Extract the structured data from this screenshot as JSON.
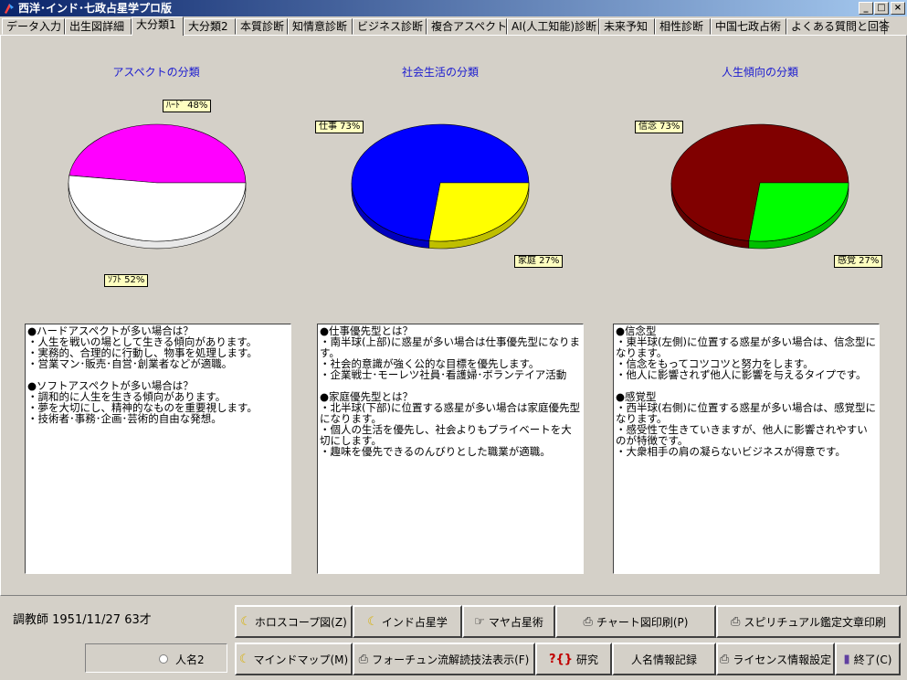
{
  "window": {
    "title": "西洋･インド･七政占星学プロ版",
    "buttons": {
      "minimize": "_",
      "maximize": "□",
      "close": "×"
    }
  },
  "tabs": [
    {
      "label": "データ入力"
    },
    {
      "label": "出生図詳細"
    },
    {
      "label": "大分類1",
      "active": true
    },
    {
      "label": "大分類2"
    },
    {
      "label": "本質診断"
    },
    {
      "label": "知情意診断"
    },
    {
      "label": "ビジネス診断"
    },
    {
      "label": "複合アスペクト"
    },
    {
      "label": "AI(人工知能)診断"
    },
    {
      "label": "未来予知"
    },
    {
      "label": "相性診断"
    },
    {
      "label": "中国七政占術"
    },
    {
      "label": "よくある質問と回答"
    }
  ],
  "chart_data": [
    {
      "type": "pie",
      "title": "アスペクトの分類",
      "slices": [
        {
          "label": "ﾊｰﾄﾞ",
          "value": 48,
          "callout": "ﾊｰﾄﾞ 48%",
          "color": "#ff00ff"
        },
        {
          "label": "ｿﾌﾄ",
          "value": 52,
          "callout": "ｿﾌﾄ 52%",
          "color": "#ffffff"
        }
      ]
    },
    {
      "type": "pie",
      "title": "社会生活の分類",
      "slices": [
        {
          "label": "仕事",
          "value": 73,
          "callout": "仕事 73%",
          "color": "#0000ff"
        },
        {
          "label": "家庭",
          "value": 27,
          "callout": "家庭 27%",
          "color": "#ffff00"
        }
      ]
    },
    {
      "type": "pie",
      "title": "人生傾向の分類",
      "slices": [
        {
          "label": "信念",
          "value": 73,
          "callout": "信念 73%",
          "color": "#800000"
        },
        {
          "label": "感覚",
          "value": 27,
          "callout": "感覚 27%",
          "color": "#00ff00"
        }
      ]
    }
  ],
  "descriptions": [
    "●ハードアスペクトが多い場合は？\n・人生を戦いの場として生きる傾向があります。\n・実務的、合理的に行動し、物事を処理します。\n・営業マン･販売･自営･創業者などが適職。\n\n●ソフトアスペクトが多い場合は？\n・調和的に人生を生きる傾向があります。\n・夢を大切にし、精神的なものを重要視します。\n・技術者･事務･企画･芸術的自由な発想。",
    "●仕事優先型とは？\n・南半球(上部)に惑星が多い場合は仕事優先型になります。\n・社会的意識が強く公的な目標を優先します。\n・企業戦士･モーレツ社員･看護婦･ボランテイア活動\n\n●家庭優先型とは？\n・北半球(下部)に位置する惑星が多い場合は家庭優先型になります。\n・個人の生活を優先し、社会よりもプライベートを大切にします。\n・趣味を優先できるのんびりとした職業が適職。",
    "●信念型\n・東半球(左側)に位置する惑星が多い場合は、信念型になります。\n・信念をもってコツコツと努力をします。\n・他人に影響されず他人に影響を与えるタイプです。\n\n●感覚型\n・西半球(右側)に位置する惑星が多い場合は、感覚型になります。\n・感受性で生きていきますが、他人に影響されやすいのが特徴です。\n・大衆相手の肩の凝らないビジネスが得意です。"
  ],
  "status": {
    "text": "調教師  1951/11/27  63才"
  },
  "name_option": {
    "label": "人名2"
  },
  "buttons": {
    "horoscope": "ホロスコープ図(Z)",
    "indian": "インド占星学",
    "maya": "マヤ占星術",
    "chart_print": "チャート図印刷(P)",
    "spiritual_print": "スピリチュアル鑑定文章印刷",
    "mindmap": "マインドマップ(M)",
    "fortune": "フォーチュン流解読技法表示(F)",
    "research": "研究",
    "name_record": "人名情報記録",
    "license": "ライセンス情報設定",
    "exit": "終了(C)"
  },
  "icons": {
    "moon": "☾",
    "printer": "⎙",
    "hand": "☞",
    "research": "?{}",
    "exit": "▮"
  }
}
